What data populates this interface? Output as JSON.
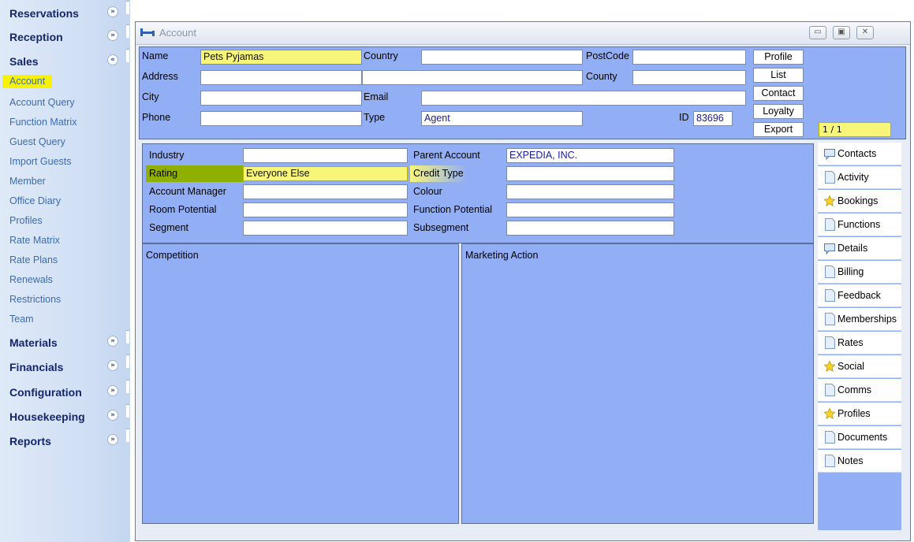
{
  "sidebar": {
    "groups_top": [
      {
        "label": "Reservations",
        "chevron": "down"
      },
      {
        "label": "Reception",
        "chevron": "down"
      },
      {
        "label": "Sales",
        "chevron": "up"
      }
    ],
    "items": [
      "Account",
      "Account Query",
      "Function Matrix",
      "Guest Query",
      "Import Guests",
      "Member",
      "Office Diary",
      "Profiles",
      "Rate Matrix",
      "Rate Plans",
      "Renewals",
      "Restrictions",
      "Team"
    ],
    "selected_item": "Account",
    "groups_bottom": [
      {
        "label": "Materials"
      },
      {
        "label": "Financials"
      },
      {
        "label": "Configuration"
      },
      {
        "label": "Housekeeping"
      },
      {
        "label": "Reports"
      }
    ]
  },
  "window": {
    "title": "Account",
    "icon": "bed-icon",
    "controls": [
      "minimize-icon",
      "restore-icon",
      "close-icon"
    ]
  },
  "form": {
    "name_label": "Name",
    "name_value": "Pets Pyjamas",
    "country_label": "Country",
    "country_value": "",
    "postcode_label": "PostCode",
    "postcode_value": "",
    "address_label": "Address",
    "address_value": "",
    "county_label": "County",
    "county_value": "",
    "city_label": "City",
    "city_value": "",
    "email_label": "Email",
    "email_value": "",
    "phone_label": "Phone",
    "phone_value": "",
    "type_label": "Type",
    "type_value": "Agent",
    "id_label": "ID",
    "id_value": "83696"
  },
  "buttons": [
    "Profile",
    "List",
    "Contact",
    "Loyalty",
    "Export"
  ],
  "pager": "1 / 1",
  "details": {
    "industry_label": "Industry",
    "industry_value": "",
    "rating_label": "Rating",
    "rating_value": "Everyone Else",
    "account_manager_label": "Account Manager",
    "account_manager_value": "",
    "room_potential_label": "Room Potential",
    "room_potential_value": "",
    "segment_label": "Segment",
    "segment_value": "",
    "parent_account_label": "Parent Account",
    "parent_account_value": "EXPEDIA, INC.",
    "credit_type_label": "Credit Type",
    "credit_type_value": "",
    "colour_label": "Colour",
    "colour_value": "",
    "function_potential_label": "Function Potential",
    "function_potential_value": "",
    "subsegment_label": "Subsegment",
    "subsegment_value": ""
  },
  "panels": {
    "competition": "Competition",
    "marketing": "Marketing Action"
  },
  "tabs": [
    {
      "label": "Contacts",
      "icon": "chat-icon"
    },
    {
      "label": "Activity",
      "icon": "document-icon"
    },
    {
      "label": "Bookings",
      "icon": "star-icon"
    },
    {
      "label": "Functions",
      "icon": "document-icon"
    },
    {
      "label": "Details",
      "icon": "chat-icon"
    },
    {
      "label": "Billing",
      "icon": "document-icon"
    },
    {
      "label": "Feedback",
      "icon": "document-icon"
    },
    {
      "label": "Memberships",
      "icon": "document-icon"
    },
    {
      "label": "Rates",
      "icon": "document-icon"
    },
    {
      "label": "Social",
      "icon": "star-icon"
    },
    {
      "label": "Comms",
      "icon": "document-icon"
    },
    {
      "label": "Profiles",
      "icon": "star-icon"
    },
    {
      "label": "Documents",
      "icon": "document-icon"
    },
    {
      "label": "Notes",
      "icon": "document-icon"
    }
  ],
  "colors": {
    "panel": "#92aef5",
    "highlight": "#f7f57a",
    "rating_highlight": "#8fb000",
    "accent": "#15256f"
  }
}
